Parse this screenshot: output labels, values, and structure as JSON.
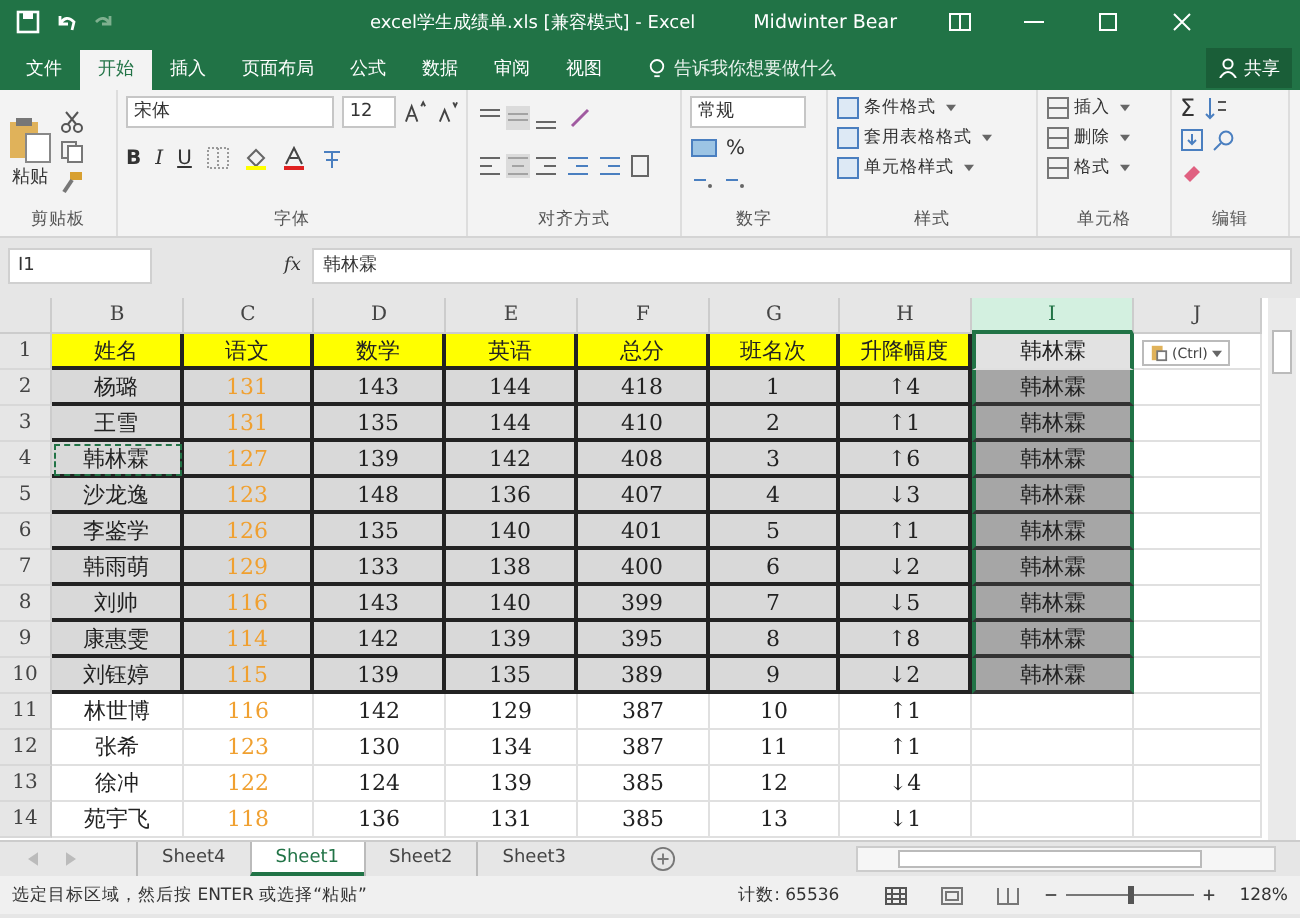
{
  "title_bar": {
    "title": "excel学生成绩单.xls  [兼容模式]  -  Excel",
    "user": "Midwinter Bear"
  },
  "ribbon_tabs": [
    {
      "label": "文件",
      "selected": false
    },
    {
      "label": "开始",
      "selected": true
    },
    {
      "label": "插入",
      "selected": false
    },
    {
      "label": "页面布局",
      "selected": false
    },
    {
      "label": "公式",
      "selected": false
    },
    {
      "label": "数据",
      "selected": false
    },
    {
      "label": "审阅",
      "selected": false
    },
    {
      "label": "视图",
      "selected": false
    }
  ],
  "tell_me": "告诉我你想要做什么",
  "share": "共享",
  "clipboard": {
    "paste": "粘贴",
    "label": "剪贴板"
  },
  "font": {
    "name": "宋体",
    "size": "12",
    "bold": "B",
    "italic": "I",
    "underline": "U",
    "label": "字体"
  },
  "alignment": {
    "label": "对齐方式"
  },
  "number": {
    "format": "常规",
    "percent": "%",
    "label": "数字"
  },
  "styles": {
    "items": [
      "条件格式",
      "套用表格格式",
      "单元格样式"
    ],
    "label": "样式"
  },
  "cells_group": {
    "items": [
      "插入",
      "删除",
      "格式"
    ],
    "label": "单元格"
  },
  "editing": {
    "sum": "Σ",
    "label": "编辑"
  },
  "formula_bar": {
    "name_box": "I1",
    "fx": "fx",
    "value": "韩林霖"
  },
  "columns": [
    {
      "label": "B",
      "selected": false
    },
    {
      "label": "C",
      "selected": false
    },
    {
      "label": "D",
      "selected": false
    },
    {
      "label": "E",
      "selected": false
    },
    {
      "label": "F",
      "selected": false
    },
    {
      "label": "G",
      "selected": false
    },
    {
      "label": "H",
      "selected": false
    },
    {
      "label": "I",
      "selected": true
    },
    {
      "label": "J",
      "selected": false
    }
  ],
  "rows": [
    {
      "num": "1",
      "kind": "header",
      "selected": true,
      "active": true,
      "marquee": false,
      "cells": [
        "姓名",
        "语文",
        "数学",
        "英语",
        "总分",
        "班名次",
        "升降幅度",
        "韩林霖"
      ]
    },
    {
      "num": "2",
      "kind": "shaded",
      "selected": true,
      "active": false,
      "marquee": false,
      "cells": [
        "杨璐",
        "131",
        "143",
        "144",
        "418",
        "1",
        "↑4",
        "韩林霖"
      ]
    },
    {
      "num": "3",
      "kind": "shaded",
      "selected": true,
      "active": false,
      "marquee": false,
      "cells": [
        "王雪",
        "131",
        "135",
        "144",
        "410",
        "2",
        "↑1",
        "韩林霖"
      ]
    },
    {
      "num": "4",
      "kind": "shaded",
      "selected": true,
      "active": false,
      "marquee": true,
      "cells": [
        "韩林霖",
        "127",
        "139",
        "142",
        "408",
        "3",
        "↑6",
        "韩林霖"
      ]
    },
    {
      "num": "5",
      "kind": "shaded",
      "selected": true,
      "active": false,
      "marquee": false,
      "cells": [
        "沙龙逸",
        "123",
        "148",
        "136",
        "407",
        "4",
        "↓3",
        "韩林霖"
      ]
    },
    {
      "num": "6",
      "kind": "shaded",
      "selected": true,
      "active": false,
      "marquee": false,
      "cells": [
        "李鉴学",
        "126",
        "135",
        "140",
        "401",
        "5",
        "↑1",
        "韩林霖"
      ]
    },
    {
      "num": "7",
      "kind": "shaded",
      "selected": true,
      "active": false,
      "marquee": false,
      "cells": [
        "韩雨萌",
        "129",
        "133",
        "138",
        "400",
        "6",
        "↓2",
        "韩林霖"
      ]
    },
    {
      "num": "8",
      "kind": "shaded",
      "selected": true,
      "active": false,
      "marquee": false,
      "cells": [
        "刘帅",
        "116",
        "143",
        "140",
        "399",
        "7",
        "↓5",
        "韩林霖"
      ]
    },
    {
      "num": "9",
      "kind": "shaded",
      "selected": true,
      "active": false,
      "marquee": false,
      "cells": [
        "康惠雯",
        "114",
        "142",
        "139",
        "395",
        "8",
        "↑8",
        "韩林霖"
      ]
    },
    {
      "num": "10",
      "kind": "shaded",
      "selected": true,
      "active": false,
      "marquee": false,
      "cells": [
        "刘钰婷",
        "115",
        "139",
        "135",
        "389",
        "9",
        "↓2",
        "韩林霖"
      ]
    },
    {
      "num": "11",
      "kind": "plain",
      "selected": false,
      "active": false,
      "marquee": false,
      "cells": [
        "林世博",
        "116",
        "142",
        "129",
        "387",
        "10",
        "↑1",
        ""
      ]
    },
    {
      "num": "12",
      "kind": "plain",
      "selected": false,
      "active": false,
      "marquee": false,
      "cells": [
        "张希",
        "123",
        "130",
        "134",
        "387",
        "11",
        "↑1",
        ""
      ]
    },
    {
      "num": "13",
      "kind": "plain",
      "selected": false,
      "active": false,
      "marquee": false,
      "cells": [
        "徐冲",
        "122",
        "124",
        "139",
        "385",
        "12",
        "↓4",
        ""
      ]
    },
    {
      "num": "14",
      "kind": "plain",
      "selected": false,
      "active": false,
      "marquee": false,
      "cells": [
        "苑宇飞",
        "118",
        "136",
        "131",
        "385",
        "13",
        "↓1",
        ""
      ]
    }
  ],
  "paste_options": "(Ctrl)",
  "sheet_tabs": [
    {
      "label": "Sheet4",
      "selected": false
    },
    {
      "label": "Sheet1",
      "selected": true
    },
    {
      "label": "Sheet2",
      "selected": false
    },
    {
      "label": "Sheet3",
      "selected": false
    }
  ],
  "status_bar": {
    "message": "选定目标区域，然后按 ENTER 或选择“粘贴”",
    "count": "计数: 65536",
    "zoom": "128%",
    "zoom_slider": {
      "level": 0.5
    }
  }
}
